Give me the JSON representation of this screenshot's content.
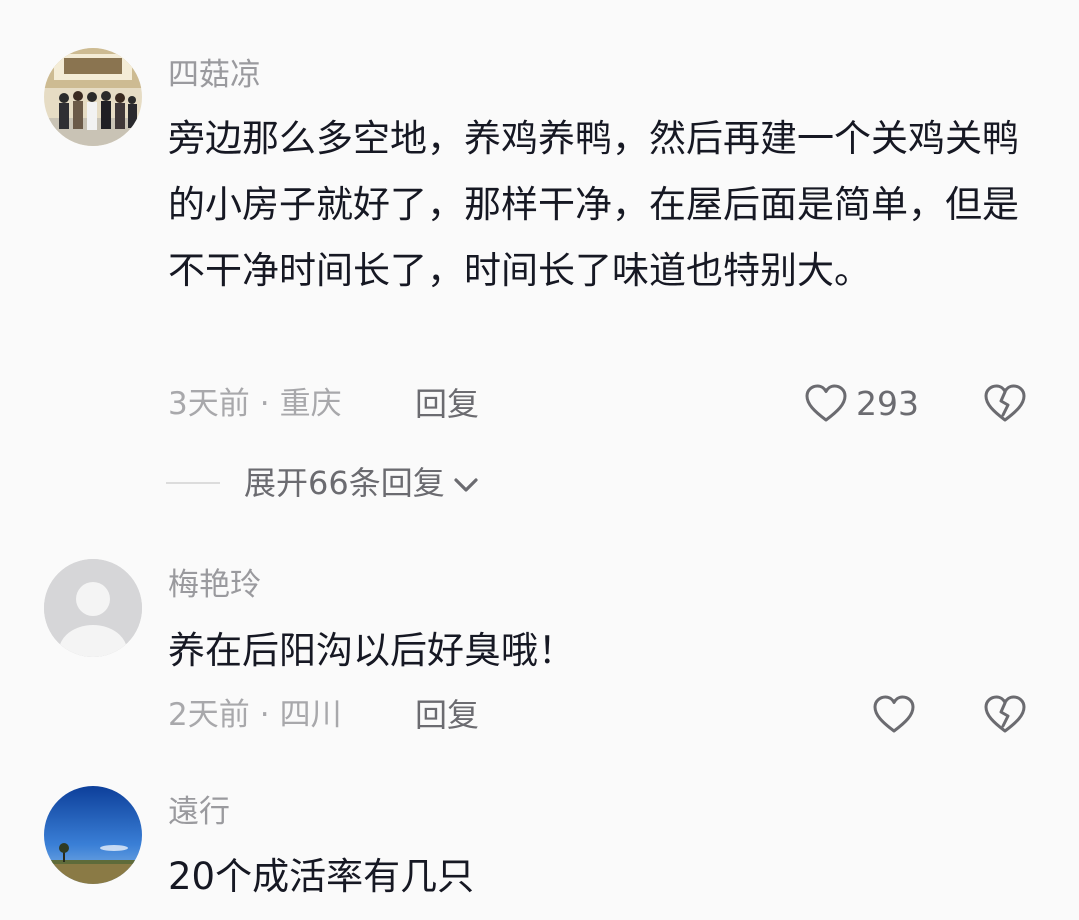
{
  "comments": [
    {
      "username": "四菇凉",
      "content": "旁边那么多空地，养鸡养鸭，然后再建一个关鸡关鸭的小房子就好了，那样干净，在屋后面是简单，但是不干净时间长了，时间长了味道也特别大。",
      "time": "3天前",
      "separator": "·",
      "location": "重庆",
      "reply_label": "回复",
      "like_count": "293",
      "avatar_icon": "group-photo-avatar"
    },
    {
      "username": "梅艳玲",
      "content": "养在后阳沟以后好臭哦！",
      "time": "2天前",
      "separator": "·",
      "location": "四川",
      "reply_label": "回复",
      "like_count": "",
      "avatar_icon": "default-user-avatar"
    },
    {
      "username": "遠行",
      "content": "20个成活率有几只",
      "avatar_icon": "sky-landscape-avatar"
    }
  ],
  "expand_replies": {
    "label": "展开66条回复"
  },
  "colors": {
    "background": "#fafafa",
    "username": "#9a9a9e",
    "content": "#161823",
    "meta": "#a8a8ab",
    "action": "#6b6b70"
  }
}
